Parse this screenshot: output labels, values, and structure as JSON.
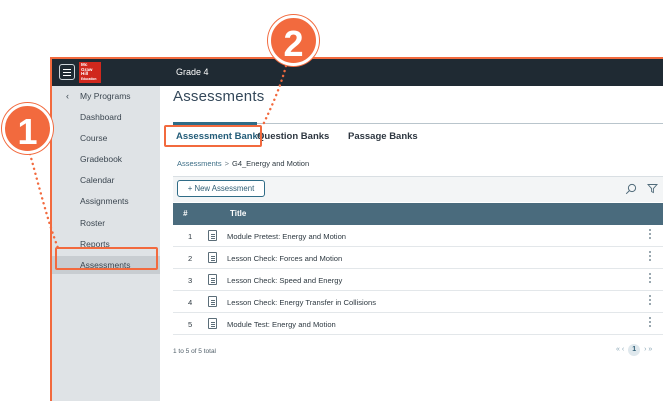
{
  "topbar": {
    "logo_lines": [
      "Mc",
      "Graw",
      "Hill",
      "Education"
    ],
    "grade": "Grade 4"
  },
  "sidebar": {
    "back_label": "My Programs",
    "items": [
      {
        "label": "Dashboard"
      },
      {
        "label": "Course"
      },
      {
        "label": "Gradebook"
      },
      {
        "label": "Calendar"
      },
      {
        "label": "Assignments"
      },
      {
        "label": "Roster"
      },
      {
        "label": "Reports"
      },
      {
        "label": "Assessments",
        "active": true
      }
    ]
  },
  "main": {
    "title": "Assessments",
    "tabs": [
      {
        "label": "Assessment Banks",
        "active": true
      },
      {
        "label": "Question Banks"
      },
      {
        "label": "Passage Banks"
      }
    ],
    "breadcrumb": {
      "root": "Assessments",
      "separator": ">",
      "current": "G4_Energy and Motion"
    },
    "new_button": "+ New Assessment",
    "table": {
      "headers": {
        "num": "#",
        "title": "Title"
      },
      "rows": [
        {
          "num": "1",
          "title": "Module Pretest: Energy and Motion"
        },
        {
          "num": "2",
          "title": "Lesson Check: Forces and Motion"
        },
        {
          "num": "3",
          "title": "Lesson Check: Speed and Energy"
        },
        {
          "num": "4",
          "title": "Lesson Check: Energy Transfer in Collisions"
        },
        {
          "num": "5",
          "title": "Module Test: Energy and Motion"
        }
      ]
    },
    "footer_count": "1 to 5 of 5 total",
    "pager": {
      "first": "«",
      "prev": "‹",
      "page": "1",
      "next": "›",
      "last": "»"
    }
  },
  "callouts": {
    "one": "1",
    "two": "2"
  },
  "colors": {
    "accent": "#f26a3e",
    "topbar": "#1f2a33",
    "header": "#4a6b7d",
    "link": "#2f6c87"
  }
}
